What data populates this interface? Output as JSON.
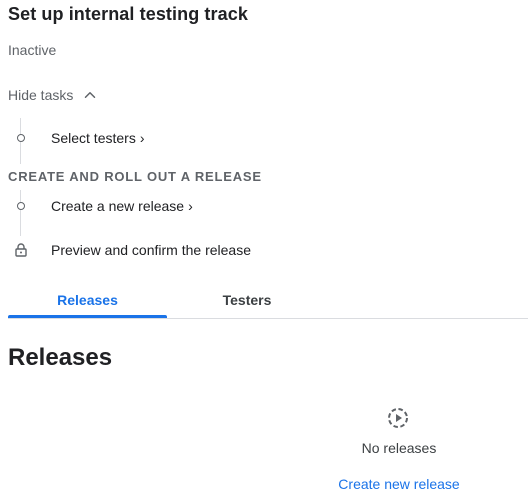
{
  "header": {
    "title": "Set up internal testing track",
    "status": "Inactive"
  },
  "tasks_toggle": {
    "label": "Hide tasks",
    "icon": "chevron-up-icon"
  },
  "tasks": {
    "select_testers": {
      "label": "Select testers",
      "icon": "circle-icon",
      "arrow": "›"
    },
    "section_heading": "CREATE AND ROLL OUT A RELEASE",
    "create_release": {
      "label": "Create a new release",
      "icon": "circle-icon",
      "arrow": "›"
    },
    "preview_confirm": {
      "label": "Preview and confirm the release",
      "icon": "lock-icon"
    }
  },
  "tabs": [
    {
      "label": "Releases",
      "active": true
    },
    {
      "label": "Testers",
      "active": false
    }
  ],
  "main": {
    "heading": "Releases",
    "empty_state": {
      "icon": "play-circle-dashed-icon",
      "text": "No releases",
      "action_label": "Create new release"
    }
  },
  "colors": {
    "accent": "#1a73e8",
    "text_primary": "#202124",
    "text_secondary": "#5f6368",
    "divider": "#dadce0"
  }
}
